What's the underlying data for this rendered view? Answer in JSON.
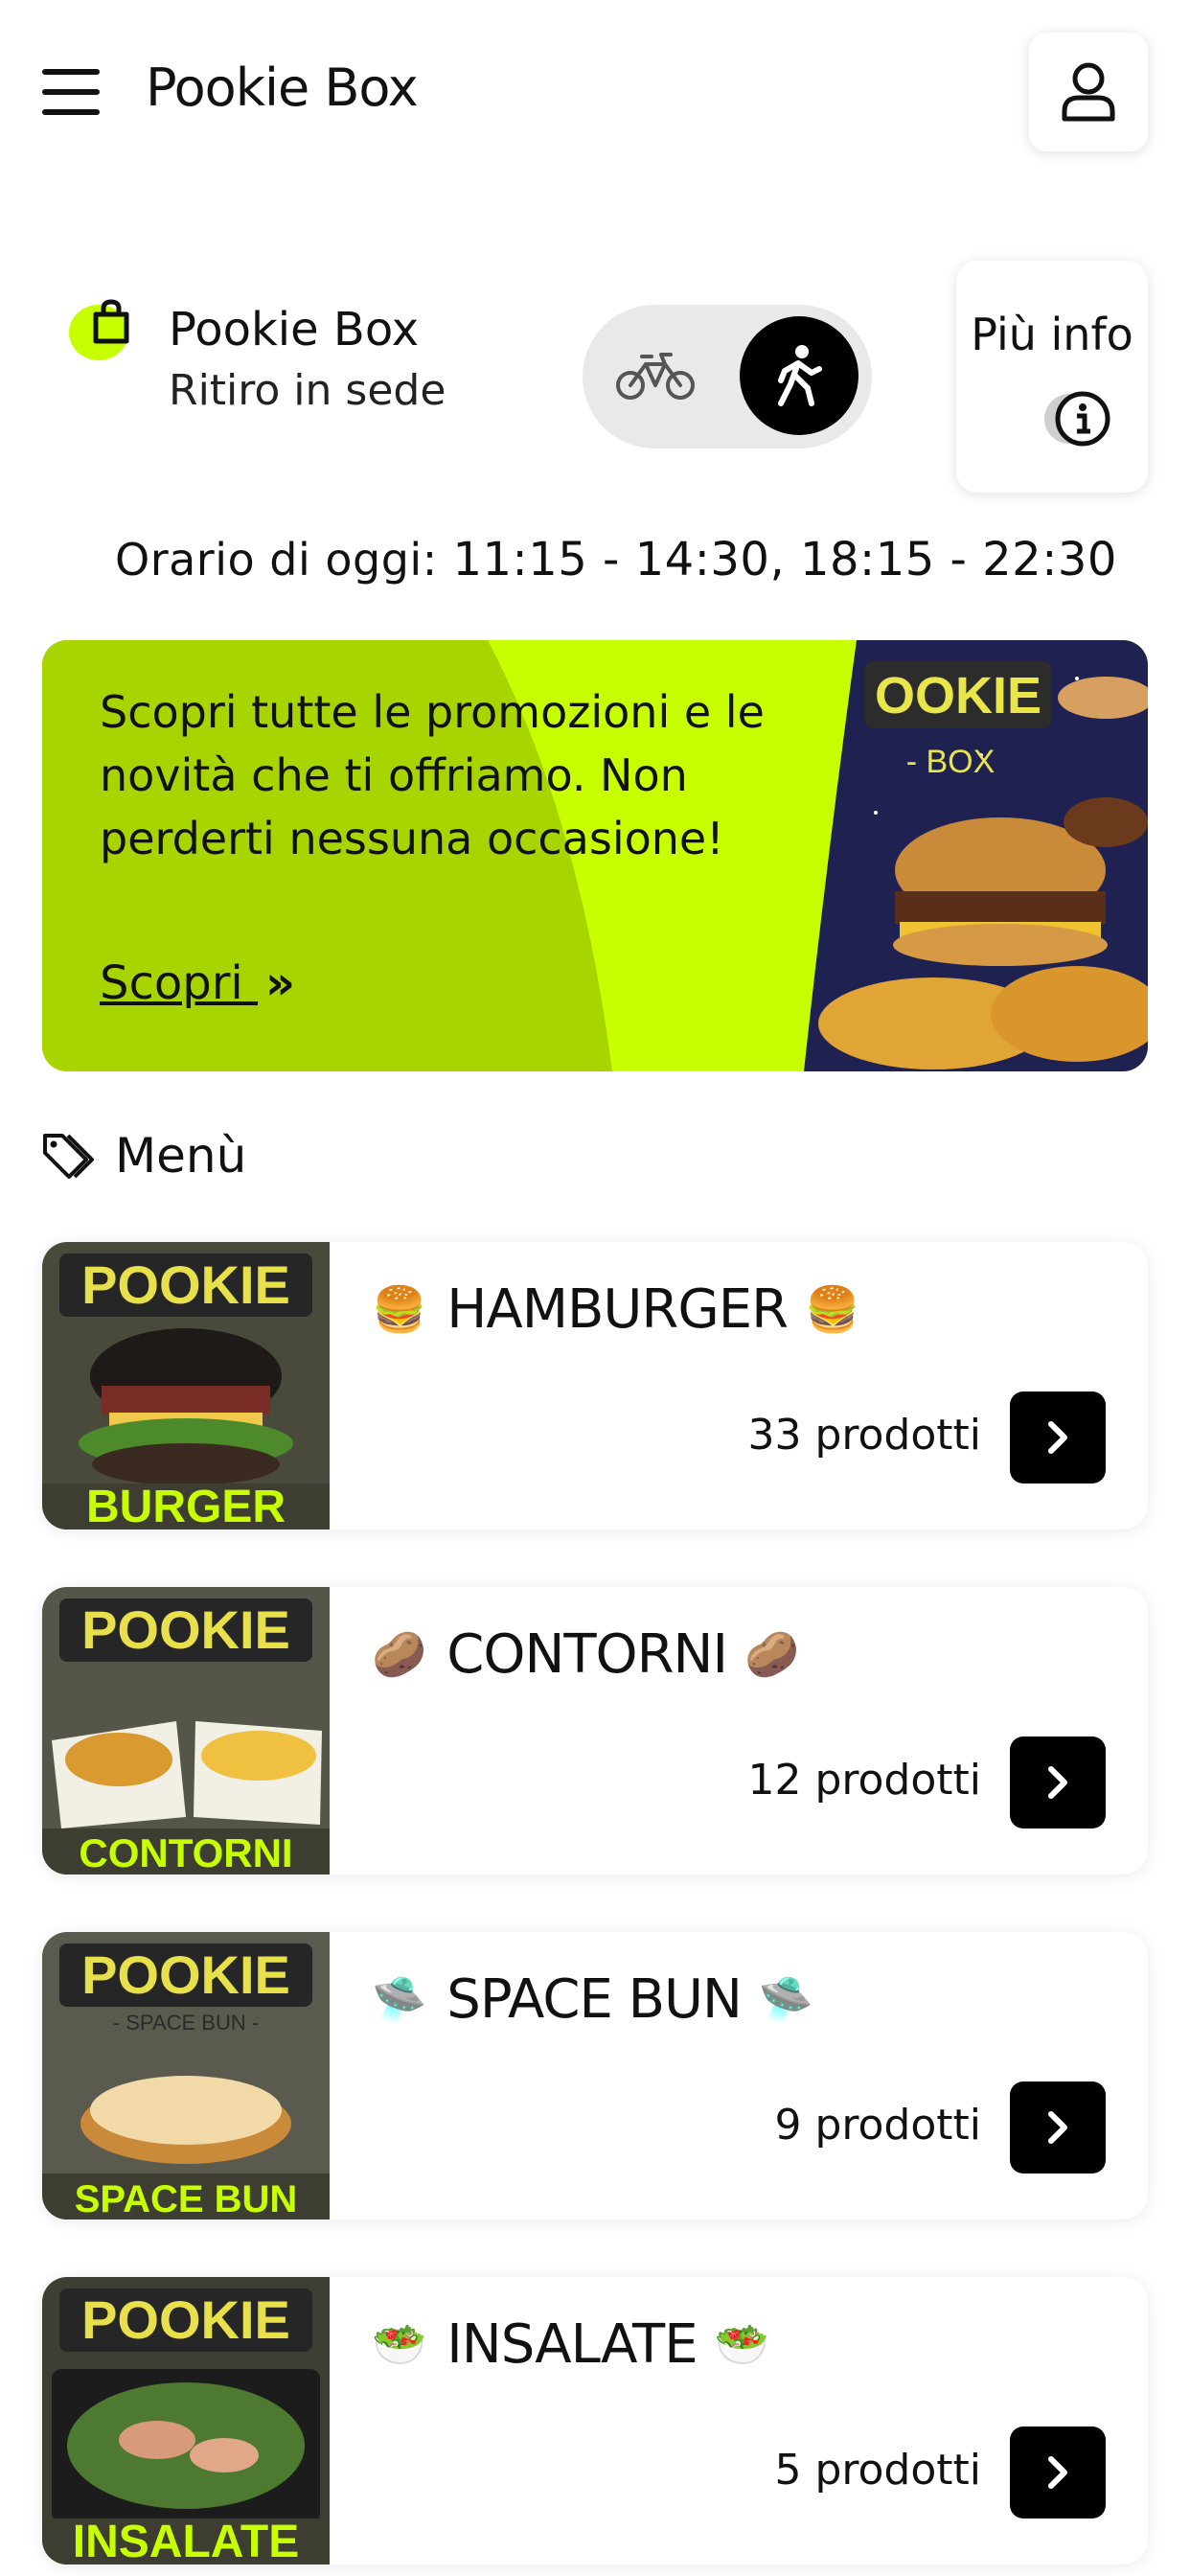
{
  "header": {
    "app_title": "Pookie Box",
    "menu_icon": "hamburger-menu-icon",
    "profile_icon": "user-icon"
  },
  "store": {
    "name": "Pookie Box",
    "mode": "Ritiro in sede",
    "icon": "shopping-bag-icon",
    "delivery_modes": [
      {
        "icon": "bike-icon",
        "selected": false
      },
      {
        "icon": "walking-person-icon",
        "selected": true
      }
    ],
    "more_info_label": "Più info",
    "more_info_icon": "info-icon"
  },
  "hours": {
    "label": "Orario di oggi:",
    "value": "11:15 - 14:30, 18:15 - 22:30"
  },
  "promo": {
    "text": "Scopri tutte le promozioni e le novità che ti offriamo. Non perderti nessuna occasione!",
    "link_label": "Scopri ",
    "link_icon": "double-chevron-right-icon",
    "image_text": "POOKIE BOX"
  },
  "menu_section": {
    "label": "Menù",
    "icon": "tags-icon"
  },
  "categories": [
    {
      "emoji": "🍔",
      "name": "HAMBURGER",
      "count": "33 prodotti",
      "image_label": "BURGER"
    },
    {
      "emoji": "🥔",
      "name": "CONTORNI",
      "count": "12 prodotti",
      "image_label": "CONTORNI"
    },
    {
      "emoji": "🛸",
      "name": "SPACE BUN",
      "count": "9 prodotti",
      "image_label": "SPACE BUN"
    },
    {
      "emoji": "🥗",
      "name": "INSALATE",
      "count": "5 prodotti",
      "image_label": "INSALATE"
    }
  ],
  "colors": {
    "accent": "#c8ff00",
    "accent_dark": "#a8d400",
    "button_dark": "#000000"
  }
}
